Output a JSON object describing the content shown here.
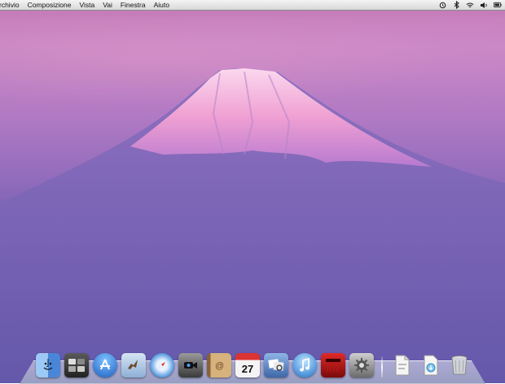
{
  "menubar": {
    "items": [
      "rchivio",
      "Composizione",
      "Vista",
      "Vai",
      "Finestra",
      "Aiuto"
    ],
    "status_icons": [
      "time-machine-icon",
      "bluetooth-icon",
      "wifi-icon",
      "volume-icon",
      "battery-icon"
    ]
  },
  "dock": {
    "apps": [
      {
        "name": "finder-icon",
        "color": "#4d8ee0"
      },
      {
        "name": "dashboard-icon",
        "color": "#3a3a3a"
      },
      {
        "name": "app-store-icon",
        "color": "#2c7fd8"
      },
      {
        "name": "mail-icon",
        "color": "#7aa6d6"
      },
      {
        "name": "safari-icon",
        "color": "#3b8ad9"
      },
      {
        "name": "facetime-icon",
        "color": "#555555"
      },
      {
        "name": "address-book-icon",
        "color": "#b08850"
      },
      {
        "name": "ical-icon",
        "color": "#eeeeee"
      },
      {
        "name": "preview-icon",
        "color": "#4d79b8"
      },
      {
        "name": "itunes-icon",
        "color": "#3a9ee8"
      },
      {
        "name": "photo-booth-icon",
        "color": "#b01818"
      },
      {
        "name": "system-preferences-icon",
        "color": "#8a8a8a"
      }
    ],
    "calendar_day": "27",
    "stacks": [
      {
        "name": "documents-stack-icon"
      },
      {
        "name": "downloads-stack-icon"
      },
      {
        "name": "trash-icon"
      }
    ]
  }
}
